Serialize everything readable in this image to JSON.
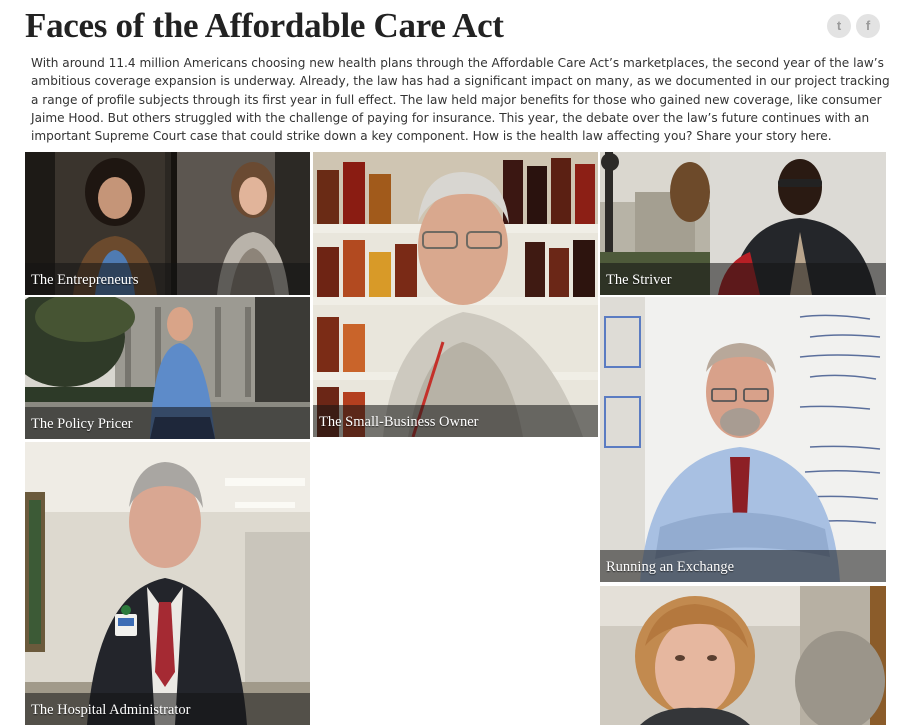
{
  "header": {
    "title": "Faces of the Affordable Care Act",
    "share": [
      {
        "icon": "twitter-icon",
        "glyph": "t"
      },
      {
        "icon": "facebook-icon",
        "glyph": "f"
      }
    ]
  },
  "intro": {
    "text": "With around 11.4 million Americans choosing new health plans through the Affordable Care Act’s marketplaces, the second year of the law’s ambitious coverage expansion is underway. Already, the law has had a significant impact on many, as we documented in our project tracking a range of profile subjects through its first year in full effect. The law held major benefits for those who gained new coverage, like consumer Jaime Hood. But others struggled with the challenge of paying for insurance. This year, the debate over the law’s future continues with an important Supreme Court case that could strike down a key component. How is the health law affecting you? ",
    "link": "Share your story here."
  },
  "profiles": [
    {
      "label": "The Entrepreneurs"
    },
    {
      "label": "The Small-Business Owner"
    },
    {
      "label": "The Striver"
    },
    {
      "label": "The Policy Pricer"
    },
    {
      "label": "Running an Exchange"
    },
    {
      "label": "The Hospital Administrator"
    },
    {
      "label": ""
    }
  ]
}
